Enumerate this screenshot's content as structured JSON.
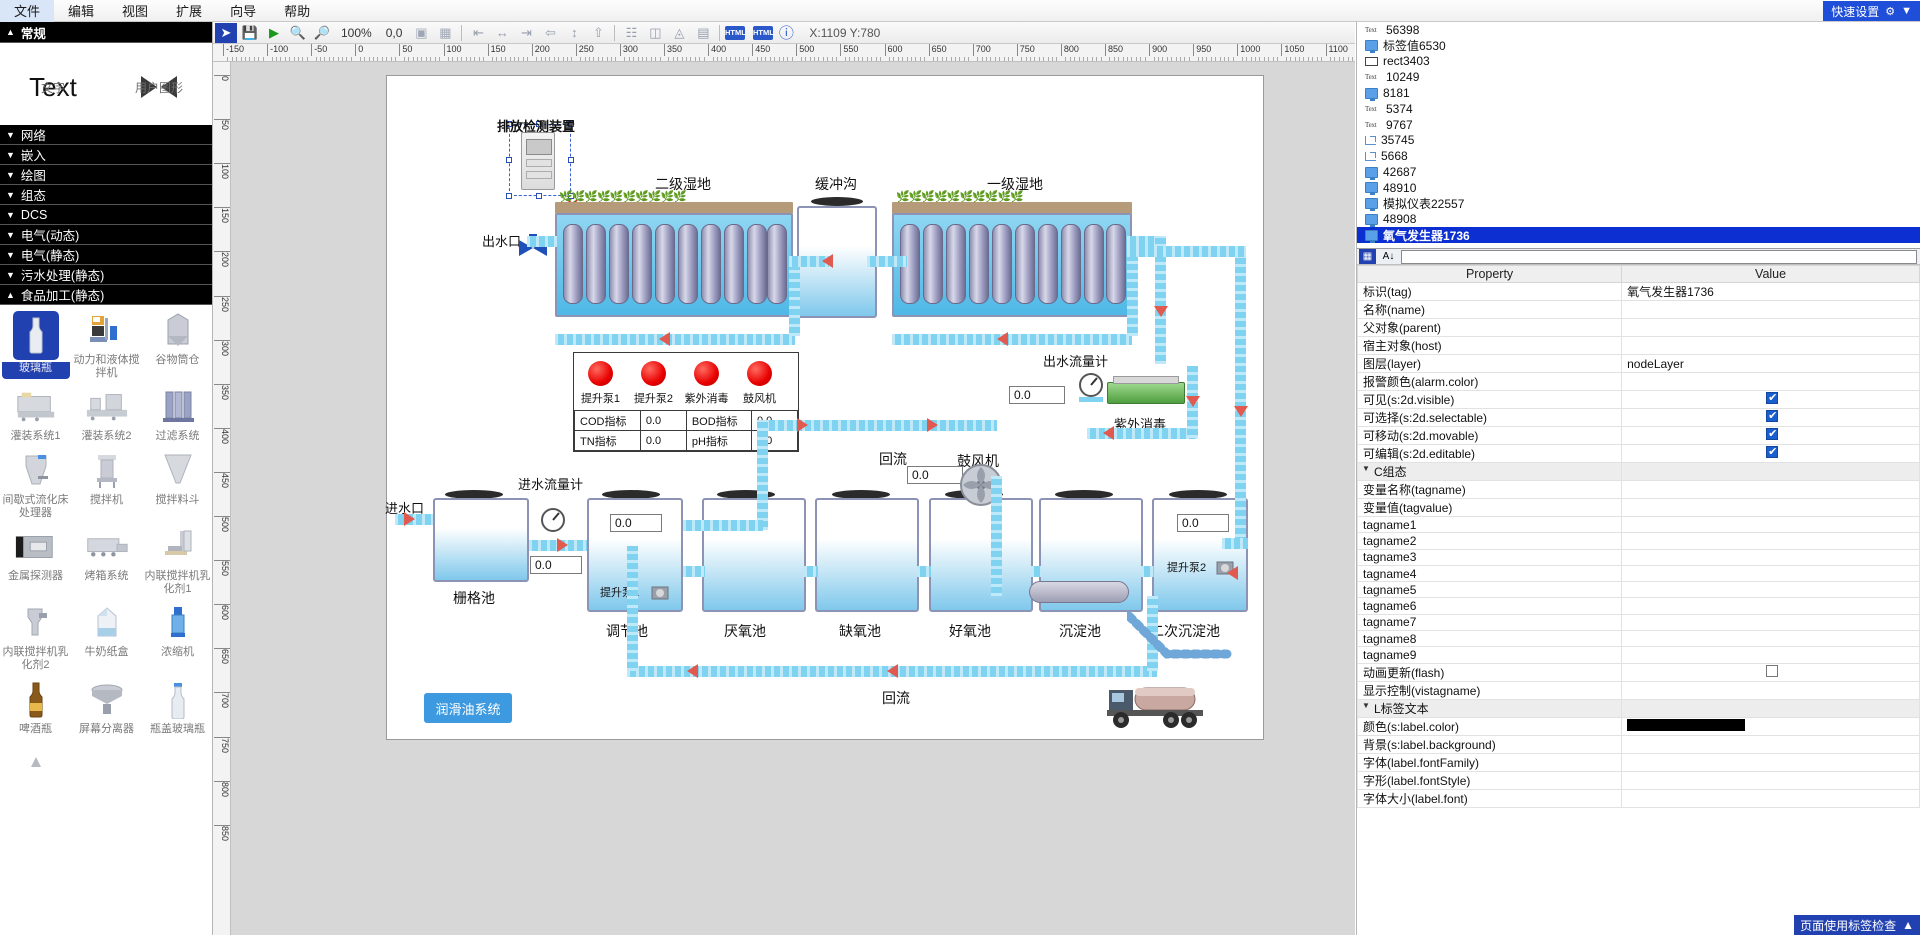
{
  "menubar": {
    "items": [
      "文件",
      "编辑",
      "视图",
      "扩展",
      "向导",
      "帮助"
    ],
    "quick_settings": "快速设置"
  },
  "toolbar": {
    "zoom_level": "100%",
    "origin": "0,0",
    "coords": "X:1109 Y:780",
    "html_button_1": "HTML",
    "html_button_2": "HTML"
  },
  "left_panel": {
    "header": "常规",
    "top_items": [
      {
        "label": "文字",
        "icon": "text-icon"
      },
      {
        "label": "用户图形",
        "icon": "user-shape-icon"
      }
    ],
    "groups": [
      {
        "label": "网络",
        "expanded": false
      },
      {
        "label": "嵌入",
        "expanded": false
      },
      {
        "label": "绘图",
        "expanded": false
      },
      {
        "label": "组态",
        "expanded": false
      },
      {
        "label": "DCS",
        "expanded": false
      },
      {
        "label": "电气(动态)",
        "expanded": false
      },
      {
        "label": "电气(静态)",
        "expanded": false
      },
      {
        "label": "污水处理(静态)",
        "expanded": false
      },
      {
        "label": "食品加工(静态)",
        "expanded": true
      }
    ],
    "palette_items": [
      {
        "label": "玻璃瓶",
        "selected": true
      },
      {
        "label": "动力和液体搅拌机",
        "selected": false
      },
      {
        "label": "谷物筒仓",
        "selected": false
      },
      {
        "label": "灌装系统1",
        "selected": false
      },
      {
        "label": "灌装系统2",
        "selected": false
      },
      {
        "label": "过滤系统",
        "selected": false
      },
      {
        "label": "间歇式流化床处理器",
        "selected": false
      },
      {
        "label": "搅拌机",
        "selected": false
      },
      {
        "label": "搅拌料斗",
        "selected": false
      },
      {
        "label": "金属探测器",
        "selected": false
      },
      {
        "label": "烤箱系统",
        "selected": false
      },
      {
        "label": "内联搅拌机乳化剂1",
        "selected": false
      },
      {
        "label": "内联搅拌机乳化剂2",
        "selected": false
      },
      {
        "label": "牛奶纸盒",
        "selected": false
      },
      {
        "label": "浓缩机",
        "selected": false
      },
      {
        "label": "啤酒瓶",
        "selected": false
      },
      {
        "label": "屏幕分离器",
        "selected": false
      },
      {
        "label": "瓶盖玻璃瓶",
        "selected": false
      }
    ]
  },
  "ruler": {
    "h_ticks": [
      "-150",
      "-100",
      "-50",
      "0",
      "50",
      "100",
      "150",
      "200",
      "250",
      "300",
      "350",
      "400",
      "450",
      "500",
      "550",
      "600",
      "650",
      "700",
      "750",
      "800",
      "850",
      "900",
      "950",
      "1000",
      "1050",
      "1100"
    ],
    "v_ticks": [
      "0",
      "50",
      "100",
      "150",
      "200",
      "250",
      "300",
      "350",
      "400",
      "450",
      "500",
      "550",
      "600",
      "650",
      "700",
      "750",
      "800",
      "850"
    ]
  },
  "right_panel": {
    "tree": [
      {
        "label": "56398",
        "icon": "text-icon",
        "prefix": "Text",
        "selected": false
      },
      {
        "label": "标签值6530",
        "icon": "monitor-icon",
        "prefix": "",
        "selected": false
      },
      {
        "label": "rect3403",
        "icon": "rect-icon",
        "prefix": "",
        "selected": false
      },
      {
        "label": "10249",
        "icon": "text-icon",
        "prefix": "Text",
        "selected": false
      },
      {
        "label": "8181",
        "icon": "monitor-icon",
        "prefix": "",
        "selected": false
      },
      {
        "label": "5374",
        "icon": "text-icon",
        "prefix": "Text",
        "selected": false
      },
      {
        "label": "9767",
        "icon": "text-icon",
        "prefix": "Text",
        "selected": false
      },
      {
        "label": "35745",
        "icon": "polyline-icon",
        "prefix": "",
        "selected": false
      },
      {
        "label": "5668",
        "icon": "polyline-icon",
        "prefix": "",
        "selected": false
      },
      {
        "label": "42687",
        "icon": "monitor-icon",
        "prefix": "",
        "selected": false
      },
      {
        "label": "48910",
        "icon": "monitor-icon",
        "prefix": "",
        "selected": false
      },
      {
        "label": "模拟仪表22557",
        "icon": "monitor-icon",
        "prefix": "",
        "selected": false
      },
      {
        "label": "48908",
        "icon": "monitor-icon",
        "prefix": "",
        "selected": false
      },
      {
        "label": "氧气发生器1736",
        "icon": "monitor-icon",
        "prefix": "",
        "selected": true
      }
    ],
    "property_header": {
      "property": "Property",
      "value": "Value"
    },
    "properties": [
      {
        "name": "标识(tag)",
        "value": "氧气发生器1736",
        "type": "text"
      },
      {
        "name": "名称(name)",
        "value": "",
        "type": "text"
      },
      {
        "name": "父对象(parent)",
        "value": "",
        "type": "text"
      },
      {
        "name": "宿主对象(host)",
        "value": "",
        "type": "text"
      },
      {
        "name": "图层(layer)",
        "value": "nodeLayer",
        "type": "text"
      },
      {
        "name": "报警颜色(alarm.color)",
        "value": "",
        "type": "text"
      },
      {
        "name": "可见(s:2d.visible)",
        "value": "",
        "type": "checkbox",
        "checked": true
      },
      {
        "name": "可选择(s:2d.selectable)",
        "value": "",
        "type": "checkbox",
        "checked": true
      },
      {
        "name": "可移动(s:2d.movable)",
        "value": "",
        "type": "checkbox",
        "checked": true
      },
      {
        "name": "可编辑(s:2d.editable)",
        "value": "",
        "type": "checkbox",
        "checked": true
      },
      {
        "name": "C组态",
        "value": "",
        "type": "group"
      },
      {
        "name": "变量名称(tagname)",
        "value": "",
        "type": "text"
      },
      {
        "name": "变量值(tagvalue)",
        "value": "",
        "type": "text"
      },
      {
        "name": "tagname1",
        "value": "",
        "type": "text"
      },
      {
        "name": "tagname2",
        "value": "",
        "type": "text"
      },
      {
        "name": "tagname3",
        "value": "",
        "type": "text"
      },
      {
        "name": "tagname4",
        "value": "",
        "type": "text"
      },
      {
        "name": "tagname5",
        "value": "",
        "type": "text"
      },
      {
        "name": "tagname6",
        "value": "",
        "type": "text"
      },
      {
        "name": "tagname7",
        "value": "",
        "type": "text"
      },
      {
        "name": "tagname8",
        "value": "",
        "type": "text"
      },
      {
        "name": "tagname9",
        "value": "",
        "type": "text"
      },
      {
        "name": "动画更新(flash)",
        "value": "",
        "type": "checkbox",
        "checked": false
      },
      {
        "name": "显示控制(vistagname)",
        "value": "",
        "type": "text"
      },
      {
        "name": "L标签文本",
        "value": "",
        "type": "group"
      },
      {
        "name": "颜色(s:label.color)",
        "value": "#000000",
        "type": "color"
      },
      {
        "name": "背景(s:label.background)",
        "value": "",
        "type": "text"
      },
      {
        "name": "字体(label.fontFamily)",
        "value": "",
        "type": "text"
      },
      {
        "name": "字形(label.fontStyle)",
        "value": "",
        "type": "text"
      },
      {
        "name": "字体大小(label.font)",
        "value": "",
        "type": "text"
      }
    ],
    "status_text": "页面使用标签检查"
  },
  "diagram": {
    "labels": {
      "discharge_monitor": "排放检测装置",
      "outlet": "出水口",
      "wetland_2": "二级湿地",
      "buffer_ditch": "缓冲沟",
      "wetland_1": "一级湿地",
      "outflow_meter": "出水流量计",
      "uv_disinfect": "紫外消毒",
      "inflow_meter": "进水流量计",
      "inlet": "进水口",
      "grid_tank": "栅格池",
      "adjust_tank": "调节池",
      "anaerobic_tank": "厌氧池",
      "anoxic_tank": "缺氧池",
      "aerobic_tank": "好氧池",
      "sediment_tank": "沉淀池",
      "secondary_sediment": "二次沉淀池",
      "return_top": "回流",
      "return_bottom": "回流",
      "blower": "鼓风机",
      "lift_pump_1_canvas": "提升泵1",
      "lift_pump_2_canvas": "提升泵2",
      "lube_system_button": "润滑油系统"
    },
    "indicator_panel": {
      "lamps": [
        {
          "label": "提升泵1",
          "color": "#e80000"
        },
        {
          "label": "提升泵2",
          "color": "#e80000"
        },
        {
          "label": "紫外消毒",
          "color": "#e80000"
        },
        {
          "label": "鼓风机",
          "color": "#e80000"
        }
      ],
      "rows": [
        [
          {
            "k": "COD指标",
            "v": "0.0"
          },
          {
            "k": "BOD指标",
            "v": "0.0"
          }
        ],
        [
          {
            "k": "TN指标",
            "v": "0.0"
          },
          {
            "k": "pH指标",
            "v": "0.0"
          }
        ]
      ]
    },
    "value_boxes": [
      {
        "name": "outflow-meter-value",
        "value": "0.0"
      },
      {
        "name": "blower-value",
        "value": "0.0"
      },
      {
        "name": "lift-pump-2-value",
        "value": "0.0"
      },
      {
        "name": "inflow-meter-value",
        "value": "0.0"
      },
      {
        "name": "grid-tank-value",
        "value": "0.0"
      },
      {
        "name": "lift-pump-1-value",
        "value": "0.0"
      }
    ]
  }
}
